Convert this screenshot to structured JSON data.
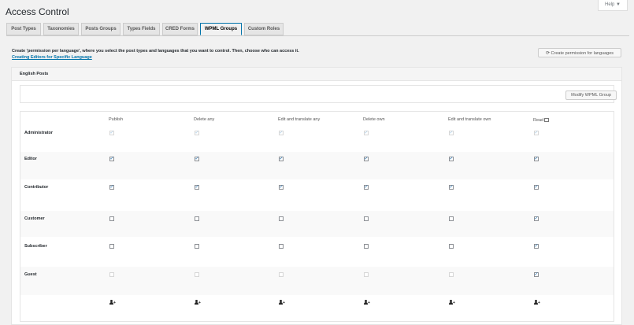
{
  "help": {
    "label": "Help ▼"
  },
  "page_title": "Access Control",
  "tabs": [
    {
      "label": "Post Types"
    },
    {
      "label": "Taxonomies"
    },
    {
      "label": "Posts Groups"
    },
    {
      "label": "Types Fields"
    },
    {
      "label": "CRED Forms"
    },
    {
      "label": "WPML Groups",
      "active": true
    },
    {
      "label": "Custom Roles"
    }
  ],
  "intro": {
    "text": "Create 'permission per language', where you select the post types and languages that you want to control. Then, choose who can access it.",
    "link": "Creating Editors for Specific Language"
  },
  "create_button": {
    "label": "Create permission for languages"
  },
  "panel": {
    "title": "English Posts",
    "modify_button": "Modify WPML Group",
    "columns": [
      "Publish",
      "Delete any",
      "Edit and translate any",
      "Delete own",
      "Edit and translate own",
      "Read"
    ],
    "roles": [
      {
        "name": "Administrator",
        "perms": [
          true,
          true,
          true,
          true,
          true,
          true
        ],
        "faded": true
      },
      {
        "name": "Editor",
        "perms": [
          true,
          true,
          true,
          true,
          true,
          true
        ],
        "faded": false
      },
      {
        "name": "Contributor",
        "perms": [
          true,
          true,
          true,
          true,
          true,
          true
        ],
        "faded": false
      },
      {
        "name": "Customer",
        "perms": [
          false,
          false,
          false,
          false,
          false,
          true
        ],
        "faded": false
      },
      {
        "name": "Subscriber",
        "perms": [
          false,
          false,
          false,
          false,
          false,
          true
        ],
        "faded": false
      },
      {
        "name": "Guest",
        "perms": [
          false,
          false,
          false,
          false,
          false,
          true
        ],
        "faded": false,
        "disabled": [
          true,
          true,
          true,
          true,
          true,
          false
        ]
      }
    ]
  },
  "colors": {
    "accent": "#0073aa",
    "check": "#2271b1"
  },
  "icons": {
    "help_dropdown": "chevron-down-icon",
    "create": "refresh-icon",
    "edit": "edit-icon",
    "add_user": "add-user-icon"
  }
}
